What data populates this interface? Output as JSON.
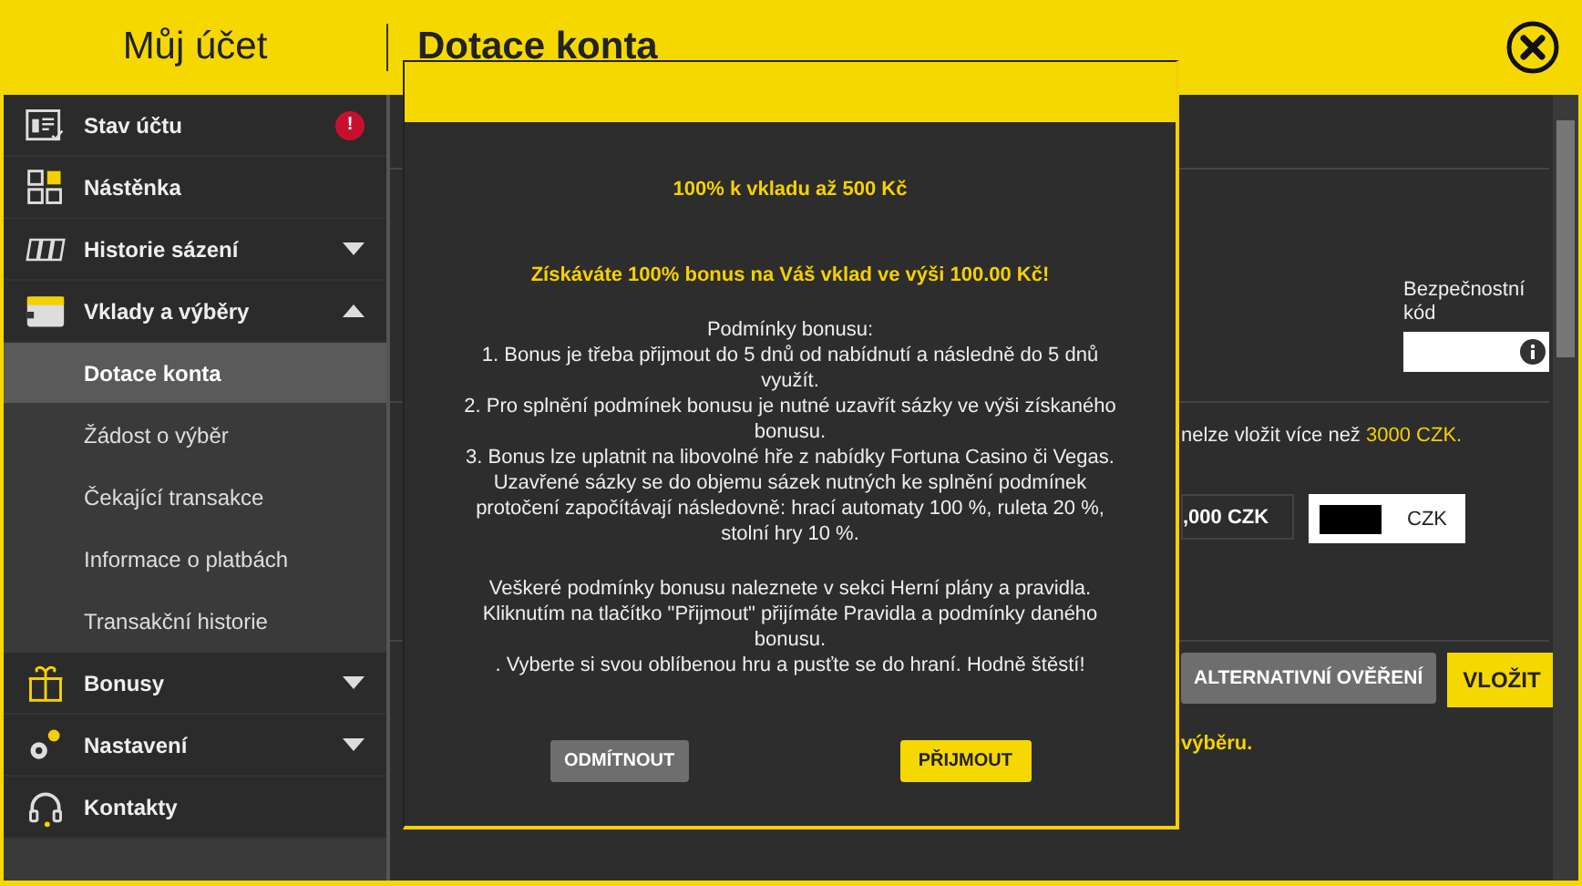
{
  "header": {
    "account_title": "Můj účet",
    "page_title": "Dotace konta"
  },
  "sidebar": {
    "items": [
      {
        "label": "Stav účtu",
        "badge": "!"
      },
      {
        "label": "Nástěnka"
      },
      {
        "label": "Historie sázení",
        "expanded": false
      },
      {
        "label": "Vklady a výběry",
        "expanded": true,
        "children": [
          {
            "label": "Dotace konta",
            "selected": true
          },
          {
            "label": "Žádost o výběr",
            "selected": false
          },
          {
            "label": "Čekající transakce",
            "selected": false
          },
          {
            "label": "Informace o platbách",
            "selected": false
          },
          {
            "label": "Transakční historie",
            "selected": false
          }
        ]
      },
      {
        "label": "Bonusy",
        "expanded": false
      },
      {
        "label": "Nastavení",
        "expanded": false
      },
      {
        "label": "Kontakty"
      }
    ]
  },
  "content": {
    "security_code_label": "Bezpečnostní kód",
    "limit_text": "nelze vložit více než ",
    "limit_amount": "3000 CZK.",
    "amount_display": ",000 CZK",
    "currency": "CZK",
    "alt_button": "ALTERNATIVNÍ OVĚŘENÍ",
    "deposit_button": "VLOŽIT",
    "note": "výběru."
  },
  "modal": {
    "heading": "100% k vkladu až 500 Kč",
    "bonus_line": "Získáváte 100% bonus na Váš vklad ve výši 100.00 Kč!",
    "conditions": [
      "Podmínky bonusu:",
      "1. Bonus je třeba přijmout do 5 dnů od nabídnutí a následně do 5 dnů využít.",
      "2. Pro splnění podmínek bonusu je nutné uzavřít sázky ve výši získaného bonusu.",
      "3. Bonus lze uplatnit na libovolné hře z nabídky Fortuna Casino či Vegas.",
      "Uzavřené sázky se do objemu sázek nutných ke splnění podmínek protočení započítávají následovně: hrací automaty 100 %, ruleta 20 %, stolní hry 10 %."
    ],
    "footer_lines": [
      "Veškeré podmínky bonusu naleznete v sekci Herní plány a pravidla.",
      "Kliknutím na tlačítko \"Přijmout\" přijímáte Pravidla a podmínky daného bonusu.",
      ". Vyberte si svou oblíbenou hru a pusťte se do hraní. Hodně štěstí!"
    ],
    "decline_button": "ODMÍTNOUT",
    "accept_button": "PŘIJMOUT"
  }
}
